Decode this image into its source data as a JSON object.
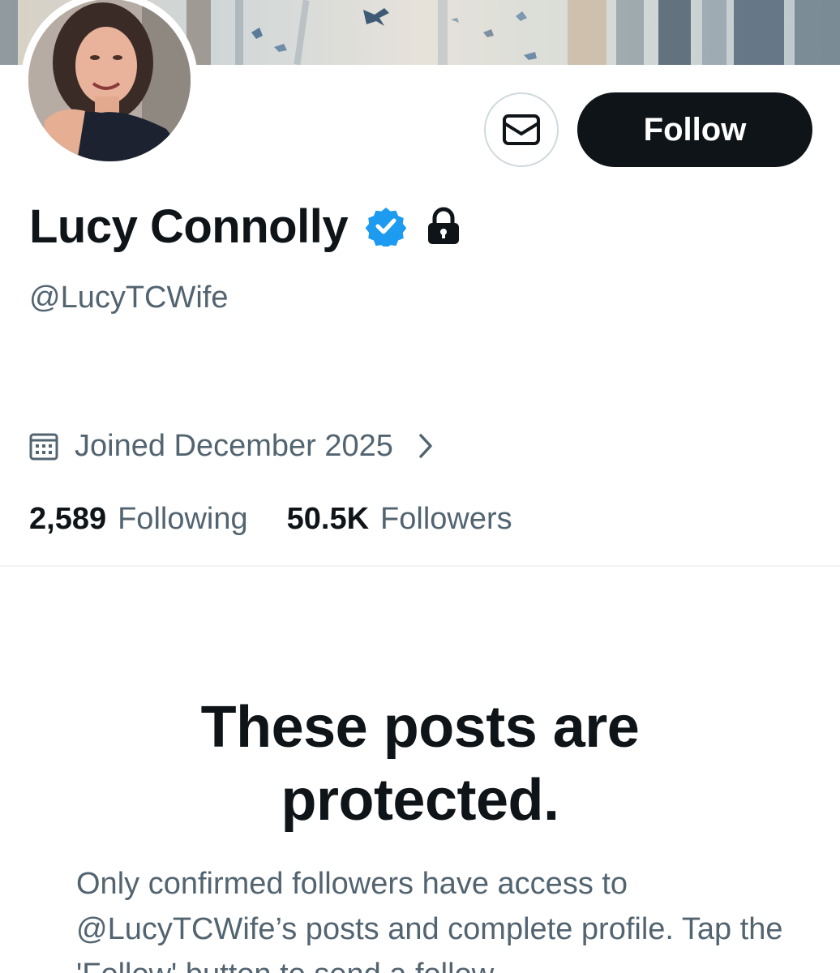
{
  "profile": {
    "display_name": "Lucy Connolly",
    "handle": "@LucyTCWife",
    "verified": true,
    "protected": true,
    "joined": "Joined December 2025"
  },
  "actions": {
    "message_icon": "envelope-icon",
    "follow_label": "Follow"
  },
  "stats": {
    "following_count": "2,589",
    "following_label": "Following",
    "followers_count": "50.5K",
    "followers_label": "Followers"
  },
  "protected_notice": {
    "title": "These posts are protected.",
    "body": "Only confirmed followers have access to @LucyTCWife’s posts and complete profile. Tap the 'Follow' button to send a follow"
  },
  "colors": {
    "primary_text": "#0f1419",
    "secondary_text": "#536471",
    "verified_blue": "#1d9bf0",
    "follow_button_bg": "#0f1419"
  }
}
